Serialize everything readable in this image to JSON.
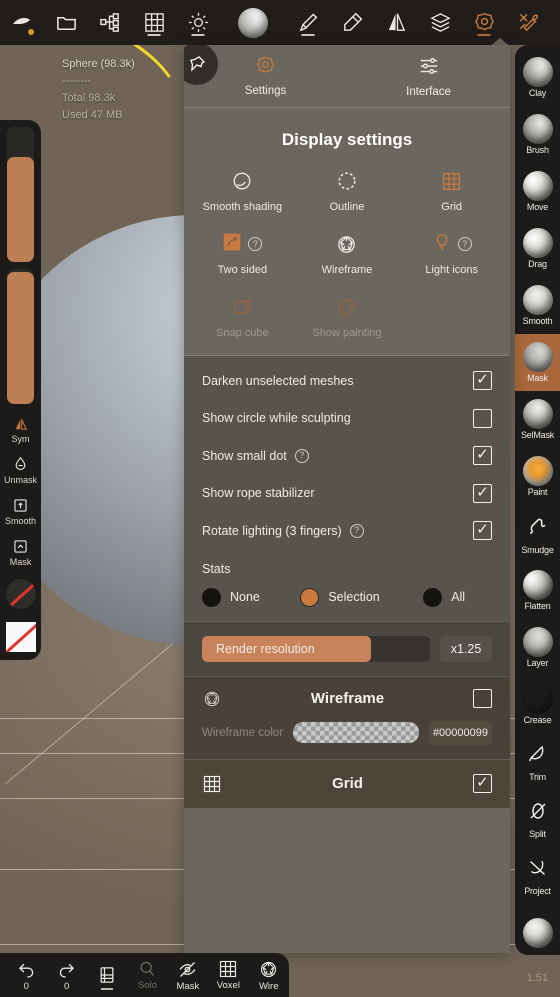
{
  "app": {
    "version": "1.51"
  },
  "topbar": {
    "items": [
      {
        "name": "sculpt-mode-icon",
        "label": ""
      },
      {
        "name": "files-icon",
        "label": ""
      },
      {
        "name": "scene-graph-icon",
        "label": ""
      },
      {
        "name": "topology-grid-icon",
        "label": ""
      },
      {
        "name": "light-icon",
        "label": ""
      },
      {
        "name": "matcap-icon",
        "label": ""
      },
      {
        "name": "brush-icon",
        "label": ""
      },
      {
        "name": "paint-icon",
        "label": ""
      },
      {
        "name": "mirror-icon",
        "label": ""
      },
      {
        "name": "layers-icon",
        "label": ""
      },
      {
        "name": "settings-icon",
        "label": ""
      },
      {
        "name": "tools-icon",
        "label": ""
      }
    ]
  },
  "stats_overlay": {
    "object": "Sphere (98.3k)",
    "divider": "--------",
    "total": "Total 98.3k",
    "used": "Used 47 MB"
  },
  "left_sidebar": {
    "slider_top_fill": 78,
    "slider_bottom_fill": 98,
    "items": [
      {
        "label": "Sym"
      },
      {
        "label": "Unmask"
      },
      {
        "label": "Smooth"
      },
      {
        "label": "Mask"
      }
    ]
  },
  "right_sidebar": {
    "active": "Mask",
    "tools": [
      {
        "label": "Clay"
      },
      {
        "label": "Brush"
      },
      {
        "label": "Move"
      },
      {
        "label": "Drag"
      },
      {
        "label": "Smooth"
      },
      {
        "label": "Mask"
      },
      {
        "label": "SelMask"
      },
      {
        "label": "Paint"
      },
      {
        "label": "Smudge"
      },
      {
        "label": "Flatten"
      },
      {
        "label": "Layer"
      },
      {
        "label": "Crease"
      },
      {
        "label": "Trim"
      },
      {
        "label": "Split"
      },
      {
        "label": "Project"
      }
    ]
  },
  "panel": {
    "tabs": [
      {
        "label": "Settings",
        "active": true
      },
      {
        "label": "Interface",
        "active": false
      }
    ],
    "title": "Display settings",
    "toggles": [
      {
        "label": "Smooth shading",
        "state": "on-white",
        "help": false
      },
      {
        "label": "Outline",
        "state": "on-white",
        "help": false
      },
      {
        "label": "Grid",
        "state": "accent",
        "help": false
      },
      {
        "label": "Two sided",
        "state": "accent",
        "help": true
      },
      {
        "label": "Wireframe",
        "state": "on-white",
        "help": false
      },
      {
        "label": "Light icons",
        "state": "accent",
        "help": true
      },
      {
        "label": "Snap cube",
        "state": "disabled",
        "help": false
      },
      {
        "label": "Show painting",
        "state": "disabled",
        "help": false
      }
    ],
    "checkbox_rows": [
      {
        "label": "Darken unselected meshes",
        "checked": true,
        "help": false
      },
      {
        "label": "Show circle while sculpting",
        "checked": false,
        "help": false
      },
      {
        "label": "Show small dot",
        "checked": true,
        "help": true
      },
      {
        "label": "Show rope stabilizer",
        "checked": true,
        "help": false
      },
      {
        "label": "Rotate lighting (3 fingers)",
        "checked": true,
        "help": true
      }
    ],
    "stats": {
      "title": "Stats",
      "options": [
        {
          "label": "None",
          "selected": false
        },
        {
          "label": "Selection",
          "selected": true
        },
        {
          "label": "All",
          "selected": false
        }
      ]
    },
    "render_resolution": {
      "label": "Render resolution",
      "value": "x1.25",
      "fill_percent": 74
    },
    "wireframe_section": {
      "title": "Wireframe",
      "enabled": false,
      "color_label": "Wireframe color",
      "color_hex": "#00000099"
    },
    "grid_section": {
      "title": "Grid",
      "enabled": true
    }
  },
  "bottombar": {
    "items": [
      {
        "name": "undo-button",
        "label": "0"
      },
      {
        "name": "redo-button",
        "label": "0"
      },
      {
        "name": "layers-button",
        "label": ""
      },
      {
        "name": "solo-button",
        "label": "Solo"
      },
      {
        "name": "mask-button",
        "label": "Mask"
      },
      {
        "name": "voxel-button",
        "label": "Voxel"
      },
      {
        "name": "wire-button",
        "label": "Wire"
      }
    ]
  },
  "colors": {
    "accent": "#c8793f",
    "panel_bg": "#6b675e",
    "dark_bg": "#1d1b19",
    "viewport_bg": "#82745f"
  }
}
